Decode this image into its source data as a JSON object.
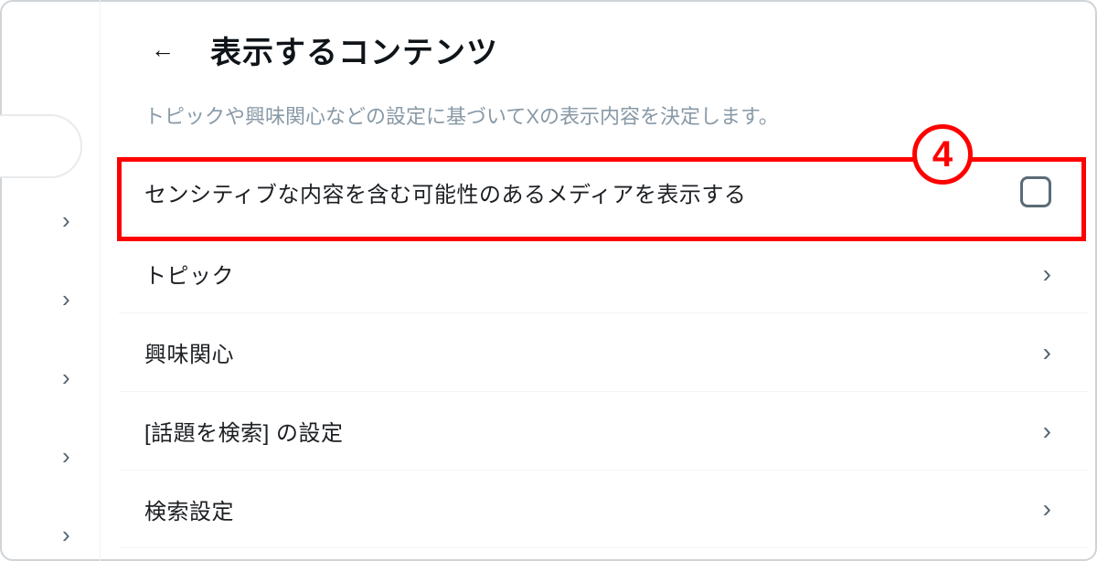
{
  "header": {
    "title": "表示するコンテンツ"
  },
  "subtitle": "トピックや興味関心などの設定に基づいてXの表示内容を決定します。",
  "sensitive_row": {
    "label": "センシティブな内容を含む可能性のあるメディアを表示する"
  },
  "rows": [
    {
      "label": "トピック"
    },
    {
      "label": "興味関心"
    },
    {
      "label": "[話題を検索] の設定"
    },
    {
      "label": "検索設定"
    }
  ],
  "annotation": {
    "number": "4"
  },
  "left_chevron_positions": [
    228,
    314,
    400,
    486,
    572
  ]
}
